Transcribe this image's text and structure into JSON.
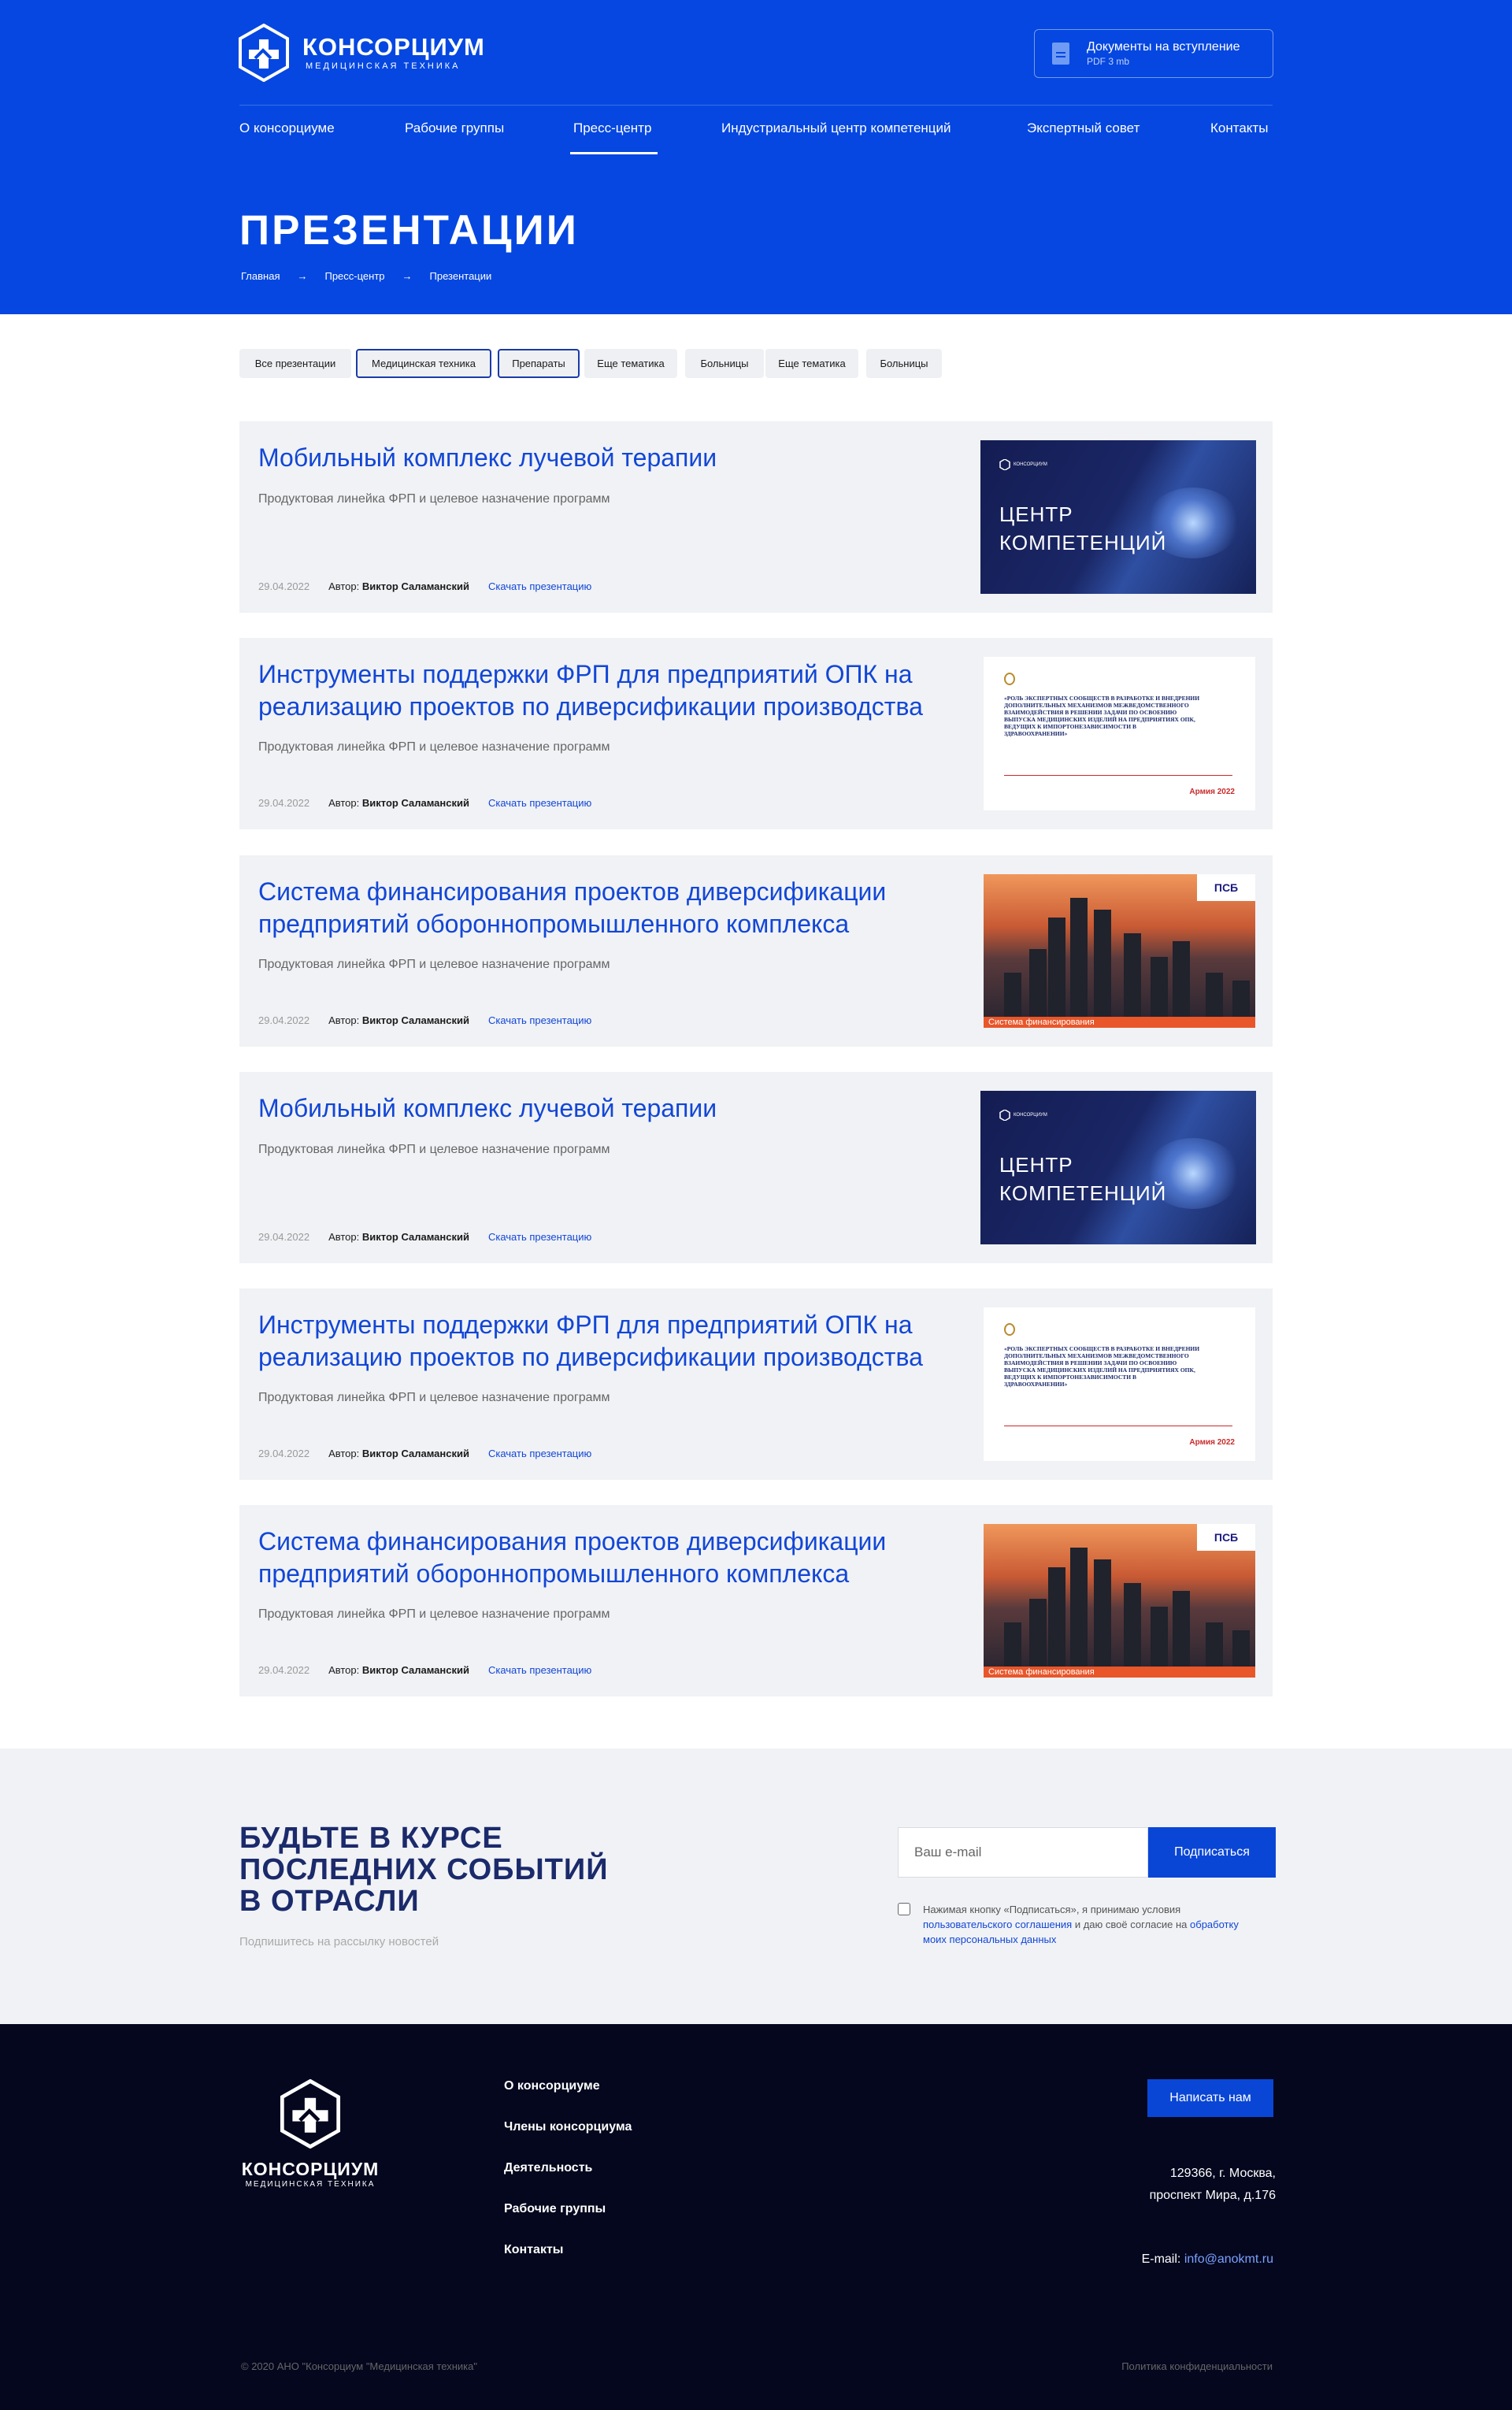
{
  "header": {
    "logo": {
      "name": "КОНСОРЦИУМ",
      "sub": "МЕДИЦИНСКАЯ ТЕХНИКА"
    },
    "docs": {
      "title": "Документы на вступление",
      "meta": "PDF 3 mb",
      "icon": "file-icon"
    },
    "nav": [
      "О консорциуме",
      "Рабочие группы",
      "Пресс-центр",
      "Индустриальный центр компетенций",
      "Экспертный совет",
      "Контакты"
    ],
    "active_nav": "Пресс-центр",
    "title": "ПРЕЗЕНТАЦИИ",
    "breadcrumb": [
      "Главная",
      "Пресс-центр",
      "Презентации"
    ],
    "breadcrumb_sep": "→"
  },
  "filters": [
    "Все презентации",
    "Медицинская техника",
    "Препараты",
    "Еще тематика",
    "Больницы",
    "Еще тематика",
    "Больницы"
  ],
  "filters_selected": [
    "Медицинская техника",
    "Препараты"
  ],
  "cards": [
    {
      "title": "Мобильный комплекс лучевой терапии",
      "subtitle": "Продуктовая линейка ФРП и целевое назначение программ",
      "date": "29.04.2022",
      "author_label": "Автор:",
      "author": "Виктор Саламанский",
      "download": "Скачать презентацию",
      "thumb": {
        "type": "center",
        "text1": "ЦЕНТР",
        "text2": "КОМПЕТЕНЦИЙ",
        "brand": "КОНСОРЦИУМ"
      }
    },
    {
      "title": "Инструменты поддержки ФРП для предприятий ОПК на реализацию проектов по диверсификации производства",
      "subtitle": "Продуктовая линейка ФРП и целевое назначение программ",
      "date": "29.04.2022",
      "author_label": "Автор:",
      "author": "Виктор Саламанский",
      "download": "Скачать презентацию",
      "thumb": {
        "type": "doc",
        "text": "«РОЛЬ ЭКСПЕРТНЫХ СООБЩЕСТВ В РАЗРАБОТКЕ И ВНЕДРЕНИИ ДОПОЛНИТЕЛЬНЫХ МЕХАНИЗМОВ МЕЖВЕДОМСТВЕННОГО ВЗАИМОДЕЙСТВИЯ В РЕШЕНИИ ЗАДАЧИ ПО ОСВОЕНИЮ ВЫПУСКА МЕДИЦИНСКИХ ИЗДЕЛИЙ НА ПРЕДПРИЯТИЯХ ОПК, ВЕДУЩИХ К ИМПОРТОНЕЗАВИСИМОСТИ В ЗДРАВООХРАНЕНИИ»",
        "badge": "Армия 2022"
      }
    },
    {
      "title": "Система финансирования проектов диверсификации предприятий оборонно­промышленного комплекса",
      "subtitle": "Продуктовая линейка ФРП и целевое назначение программ",
      "date": "29.04.2022",
      "author_label": "Автор:",
      "author": "Виктор Саламанский",
      "download": "Скачать презентацию",
      "thumb": {
        "type": "city",
        "bar": "Система финансирования",
        "badge": "ПСБ"
      }
    },
    {
      "title": "Мобильный комплекс лучевой терапии",
      "subtitle": "Продуктовая линейка ФРП и целевое назначение программ",
      "date": "29.04.2022",
      "author_label": "Автор:",
      "author": "Виктор Саламанский",
      "download": "Скачать презентацию",
      "thumb": {
        "type": "center",
        "text1": "ЦЕНТР",
        "text2": "КОМПЕТЕНЦИЙ",
        "brand": "КОНСОРЦИУМ"
      }
    },
    {
      "title": "Инструменты поддержки ФРП для предприятий ОПК на реализацию проектов по диверсификации производства",
      "subtitle": "Продуктовая линейка ФРП и целевое назначение программ",
      "date": "29.04.2022",
      "author_label": "Автор:",
      "author": "Виктор Саламанский",
      "download": "Скачать презентацию",
      "thumb": {
        "type": "doc",
        "text": "«РОЛЬ ЭКСПЕРТНЫХ СООБЩЕСТВ В РАЗРАБОТКЕ И ВНЕДРЕНИИ ДОПОЛНИТЕЛЬНЫХ МЕХАНИЗМОВ МЕЖВЕДОМСТВЕННОГО ВЗАИМОДЕЙСТВИЯ В РЕШЕНИИ ЗАДАЧИ ПО ОСВОЕНИЮ ВЫПУСКА МЕДИЦИНСКИХ ИЗДЕЛИЙ НА ПРЕДПРИЯТИЯХ ОПК, ВЕДУЩИХ К ИМПОРТОНЕЗАВИСИМОСТИ В ЗДРАВООХРАНЕНИИ»",
        "badge": "Армия 2022"
      }
    },
    {
      "title": "Система финансирования проектов диверсификации предприятий оборонно­промышленного комплекса",
      "subtitle": "Продуктовая линейка ФРП и целевое назначение программ",
      "date": "29.04.2022",
      "author_label": "Автор:",
      "author": "Виктор Саламанский",
      "download": "Скачать презентацию",
      "thumb": {
        "type": "city",
        "bar": "Система финансирования",
        "badge": "ПСБ"
      }
    }
  ],
  "subscribe": {
    "title_lines": [
      "БУДЬТЕ В КУРСЕ",
      "ПОСЛЕДНИХ СОБЫТИЙ",
      "В ОТРАСЛИ"
    ],
    "hint": "Подпишитесь на рассылку новостей",
    "placeholder": "Ваш e-mail",
    "button": "Подписаться",
    "agree_text": "Нажимая кнопку «Подписаться», я принимаю условия",
    "agree_link1": "пользовательского соглашения",
    "agree_mid": "и даю своё согласие на",
    "agree_link2": "обработку моих персональных данных"
  },
  "footer": {
    "logo": {
      "name": "КОНСОРЦИУМ",
      "sub": "МЕДИЦИНСКАЯ ТЕХНИКА"
    },
    "nav": [
      "О консорциуме",
      "Члены консорциума",
      "Деятельность",
      "Рабочие группы",
      "Контакты"
    ],
    "button": "Написать нам",
    "address": [
      "129366, г. Москва,",
      "проспект Мира, д.176"
    ],
    "email_label": "E-mail:",
    "email": "info@anokmt.ru",
    "copyright": "© 2020 АНО \"Консорциум \"Медицинская техника\"",
    "policy": "Политика конфиденциальности"
  },
  "colors": {
    "brand": "#0547e0",
    "dark": "#04071d",
    "accent_link": "#1246d6"
  }
}
